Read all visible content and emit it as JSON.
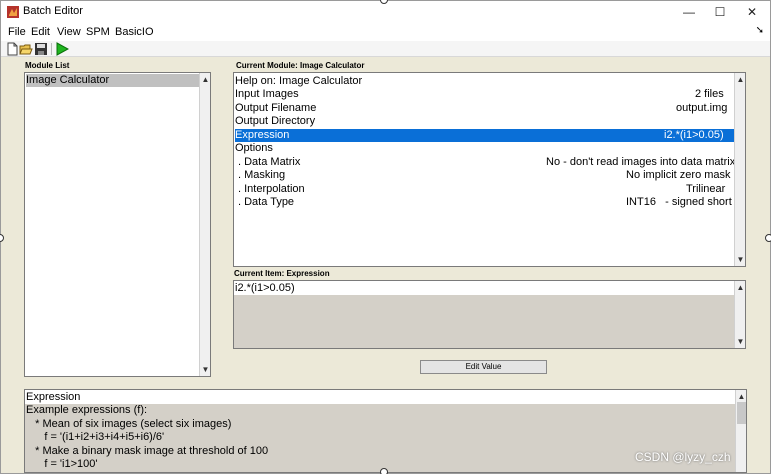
{
  "window": {
    "title": "Batch Editor",
    "controls": {
      "minimize": "—",
      "maximize": "☐",
      "close": "✕"
    }
  },
  "menu": {
    "items": [
      "File",
      "Edit",
      "View",
      "SPM",
      "BasicIO"
    ],
    "overflow_arrow": "➘"
  },
  "toolbar": {
    "icons": [
      "new-file-icon",
      "open-folder-icon",
      "save-icon",
      "run-icon"
    ]
  },
  "module_list": {
    "label": "Module List",
    "items": [
      "Image Calculator"
    ]
  },
  "current_module": {
    "label": "Current Module: Image Calculator",
    "rows": [
      {
        "label": "Help on: Image Calculator",
        "value": ""
      },
      {
        "label": "Input Images",
        "value": "2 files"
      },
      {
        "label": "Output Filename",
        "value": "output.img"
      },
      {
        "label": "Output Directory",
        "value": ""
      },
      {
        "label": "Expression",
        "value": "i2.*(i1>0.05)"
      },
      {
        "label": "Options",
        "value": ""
      },
      {
        "label": ". Data Matrix",
        "value": "No - don't read images into data matrix"
      },
      {
        "label": ". Masking",
        "value": "No implicit zero mask"
      },
      {
        "label": ". Interpolation",
        "value": "Trilinear"
      },
      {
        "label": ". Data Type",
        "value": "INT16   - signed short"
      }
    ],
    "selected_index": 4
  },
  "current_item": {
    "label": "Current Item: Expression",
    "value": "i2.*(i1>0.05)"
  },
  "edit_value_button": "Edit Value",
  "help": {
    "lines": [
      "Expression",
      "Example expressions (f):",
      "   * Mean of six images (select six images)",
      "      f = '(i1+i2+i3+i4+i5+i6)/6'",
      "   * Make a binary mask image at threshold of 100",
      "      f = 'i1>100'"
    ]
  },
  "watermark": "CSDN @lyzy_czh",
  "colors": {
    "selection": "#0a6fd7",
    "panel": "#ece9d8",
    "disabled_area": "#d4d0c8"
  }
}
